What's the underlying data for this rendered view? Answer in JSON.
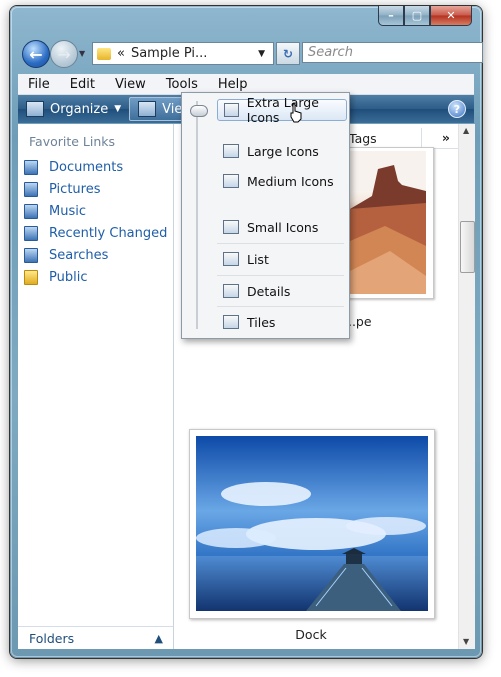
{
  "address": {
    "path_prefix": "«",
    "folder": "Sample Pi...",
    "dropdown": "▼"
  },
  "search": {
    "placeholder": "Search"
  },
  "menubar": {
    "file": "File",
    "edit": "Edit",
    "view": "View",
    "tools": "Tools",
    "help": "Help"
  },
  "toolbar": {
    "organize": "Organize",
    "views": "Views",
    "help_symbol": "?"
  },
  "left_panel": {
    "title": "Favorite Links",
    "links": [
      "Documents",
      "Pictures",
      "Music",
      "Recently Changed",
      "Searches",
      "Public"
    ],
    "folders_label": "Folders"
  },
  "columns": {
    "tags": "Tags",
    "more": "»"
  },
  "items": [
    {
      "label": "...pe"
    },
    {
      "label": "Dock"
    }
  ],
  "views_menu": {
    "items": [
      "Extra Large Icons",
      "Large Icons",
      "Medium Icons",
      "Small Icons",
      "List",
      "Details",
      "Tiles"
    ],
    "selected": "Extra Large Icons"
  }
}
